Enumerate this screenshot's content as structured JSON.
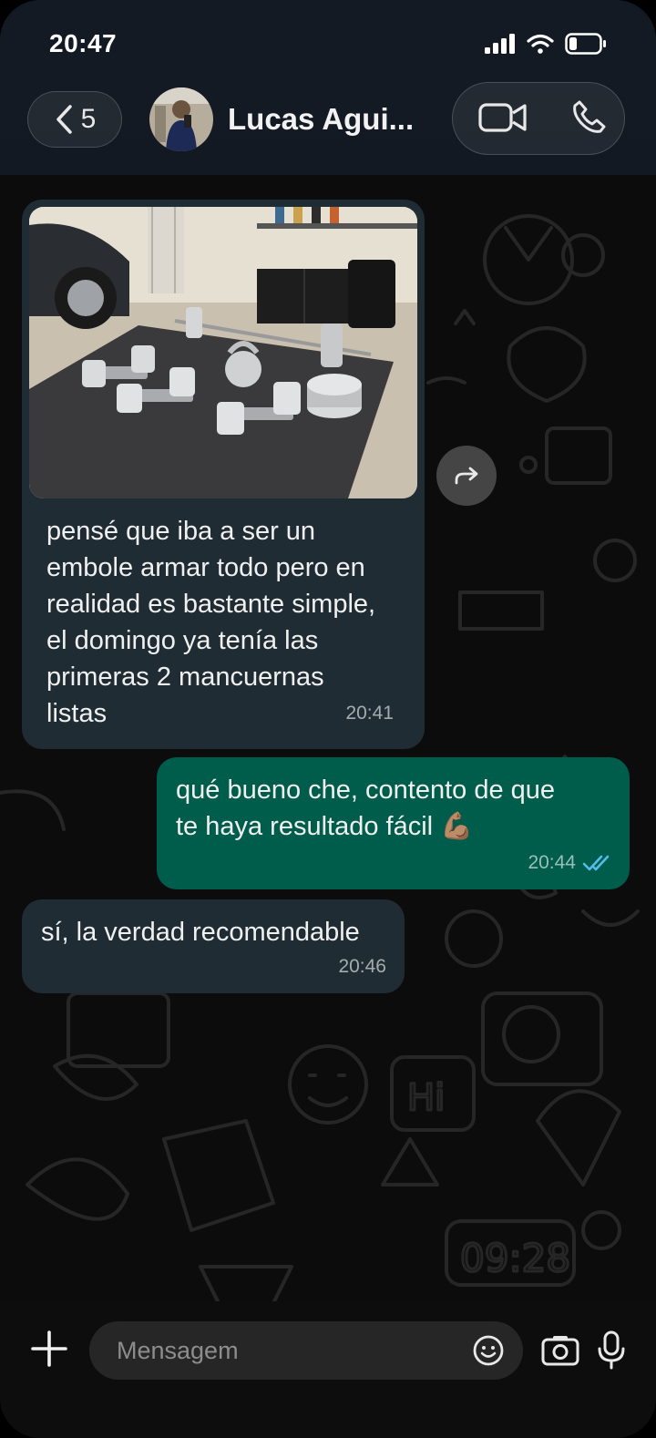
{
  "status_bar": {
    "time": "20:47"
  },
  "header": {
    "back_count": "5",
    "contact_name": "Lucas Agui...",
    "icons": [
      "chevron-left-icon",
      "video-call-icon",
      "phone-icon"
    ]
  },
  "messages": [
    {
      "direction": "incoming",
      "has_photo": true,
      "photo_description": "weights",
      "lines": [
        "pensé que iba a ser un",
        "embole armar todo pero en",
        "realidad es bastante simple,",
        "el domingo ya tenía las",
        "primeras 2 mancuernas",
        "listas"
      ],
      "time": "20:41"
    },
    {
      "direction": "outgoing",
      "lines": [
        "qué bueno che, contento de que",
        "te haya resultado fácil 💪🏽"
      ],
      "time": "20:44",
      "status": "read"
    },
    {
      "direction": "incoming",
      "lines": [
        "sí, la verdad recomendable"
      ],
      "time": "20:46"
    }
  ],
  "input_bar": {
    "placeholder": "Mensagem"
  },
  "colors": {
    "incoming_bubble": "#1f2c33",
    "outgoing_bubble": "#005c4b",
    "read_ticks": "#53bdeb"
  }
}
